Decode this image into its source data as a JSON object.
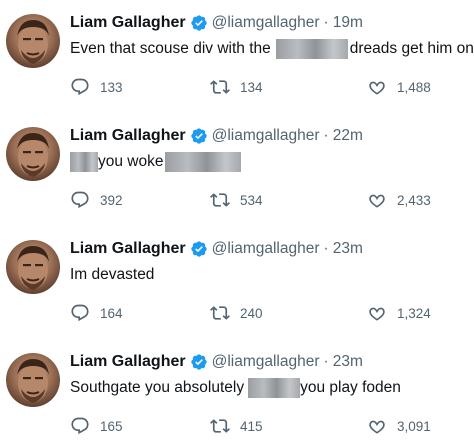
{
  "tweets": [
    {
      "author": "Liam Gallagher",
      "handle": "@liamgallagher",
      "separator": "·",
      "time": "19m",
      "text_before": "Even that scouse div with the",
      "text_after": "dreads get him on",
      "replies": "133",
      "retweets": "134",
      "likes": "1,488"
    },
    {
      "author": "Liam Gallagher",
      "handle": "@liamgallagher",
      "separator": "·",
      "time": "22m",
      "text_before": "",
      "text_middle": "you woke",
      "text_after": "",
      "replies": "392",
      "retweets": "534",
      "likes": "2,433"
    },
    {
      "author": "Liam Gallagher",
      "handle": "@liamgallagher",
      "separator": "·",
      "time": "23m",
      "text_before": "Im devasted",
      "replies": "164",
      "retweets": "240",
      "likes": "1,324"
    },
    {
      "author": "Liam Gallagher",
      "handle": "@liamgallagher",
      "separator": "·",
      "time": "23m",
      "text_before": "Southgate you absolutely",
      "text_after": "you play foden",
      "replies": "165",
      "retweets": "415",
      "likes": "3,091"
    }
  ],
  "icons": {
    "reply": "reply-icon",
    "retweet": "retweet-icon",
    "like": "heart-icon",
    "verified": "verified-badge-icon"
  },
  "colors": {
    "verified_blue": "#1d9bf0",
    "secondary_text": "#536471",
    "primary_text": "#0f1419"
  }
}
